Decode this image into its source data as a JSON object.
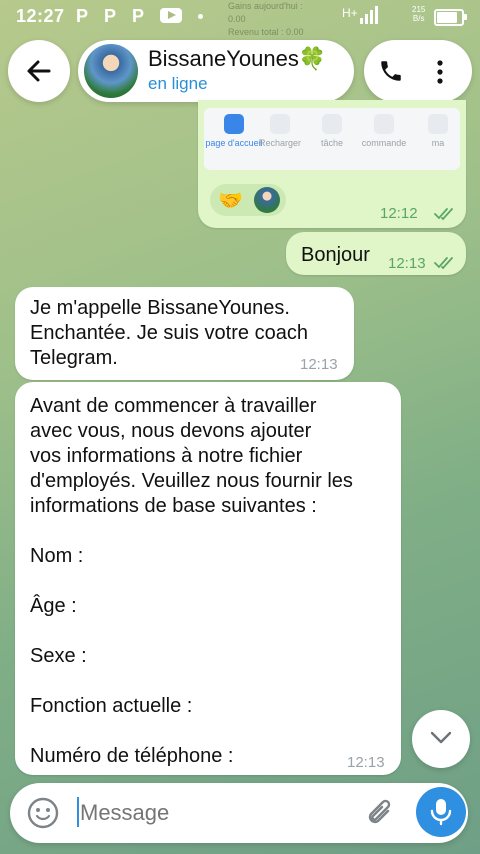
{
  "status_bar": {
    "time": "12:27",
    "notif_letters": [
      "P",
      "P",
      "P"
    ],
    "network": "H+",
    "speed_top": "215",
    "speed_bottom": "B/s"
  },
  "background_ghost": {
    "line1": "Gains aujourd'hui :",
    "line2": "0.00",
    "line3": "Revenu total : 0.00",
    "line4": "0.00"
  },
  "header": {
    "contact_name": "BissaneYounes🍀",
    "presence": "en ligne"
  },
  "mini_app_nav": {
    "items": [
      {
        "label": "page d'accueil",
        "active": true
      },
      {
        "label": "Recharger"
      },
      {
        "label": "tâche"
      },
      {
        "label": "commande"
      },
      {
        "label": "ma"
      }
    ]
  },
  "messages": [
    {
      "dir": "out",
      "emoji": "🤝",
      "time": "12:12",
      "read": true
    },
    {
      "dir": "out",
      "text": "Bonjour",
      "time": "12:13",
      "read": true
    },
    {
      "dir": "in",
      "text": "Je m'appelle BissaneYounes.\nEnchantée. Je suis votre coach\nTelegram.",
      "time": "12:13"
    },
    {
      "dir": "in",
      "text": "Avant de commencer à travailler\navec vous, nous devons ajouter\nvos informations à notre fichier\nd'employés. Veuillez nous fournir les\ninformations de base suivantes :\n\nNom :\n\nÂge :\n\nSexe :\n\nFonction actuelle :\n\nNuméro de téléphone :",
      "time": "12:13"
    }
  ],
  "composer": {
    "placeholder": "Message"
  },
  "colors": {
    "outgoing_bubble": "#e0f5c8",
    "incoming_bubble": "#ffffff",
    "accent": "#2b8fd6",
    "mic_button": "#2f8fe0",
    "tick": "#5aa56a"
  }
}
